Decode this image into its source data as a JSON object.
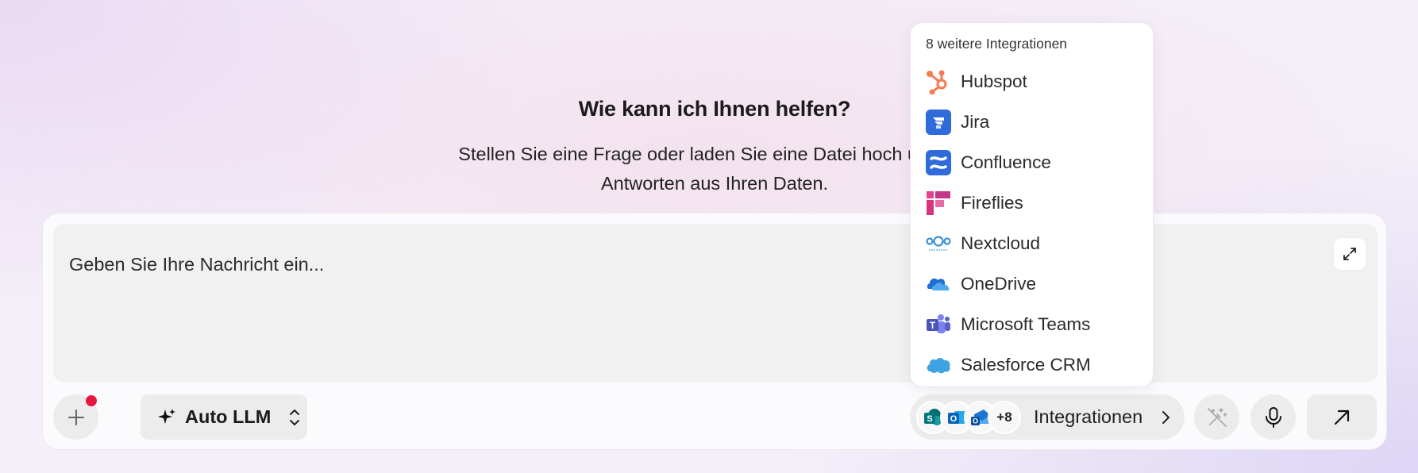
{
  "hero": {
    "title": "Wie kann ich Ihnen helfen?",
    "subtitle_line1": "Stellen Sie eine Frage oder laden Sie eine Datei hoch und erh",
    "subtitle_line2": "Antworten aus Ihren Daten."
  },
  "composer": {
    "placeholder": "Geben Sie Ihre Nachricht ein...",
    "model_label": "Auto LLM",
    "integrations_count_badge": "+8",
    "integrations_label": "Integrationen"
  },
  "integrations_dropdown": {
    "header": "8 weitere Integrationen",
    "items": [
      {
        "label": "Hubspot",
        "icon": "hubspot-icon",
        "color": "#f57b51"
      },
      {
        "label": "Jira",
        "icon": "jira-icon",
        "color": "#2f6bdb"
      },
      {
        "label": "Confluence",
        "icon": "confluence-icon",
        "color": "#2f6bdb"
      },
      {
        "label": "Fireflies",
        "icon": "fireflies-icon",
        "color": "#d4367e"
      },
      {
        "label": "Nextcloud",
        "icon": "nextcloud-icon",
        "color": "#3a8fd8"
      },
      {
        "label": "OneDrive",
        "icon": "onedrive-icon",
        "color": "#1f6fd0"
      },
      {
        "label": "Microsoft Teams",
        "icon": "teams-icon",
        "color": "#5b5fc7"
      },
      {
        "label": "Salesforce CRM",
        "icon": "salesforce-icon",
        "color": "#3ea3e0"
      }
    ]
  },
  "colors": {
    "notification_dot": "#e5173f",
    "button_bg": "#ececec",
    "textarea_bg": "#f1f1f1"
  }
}
